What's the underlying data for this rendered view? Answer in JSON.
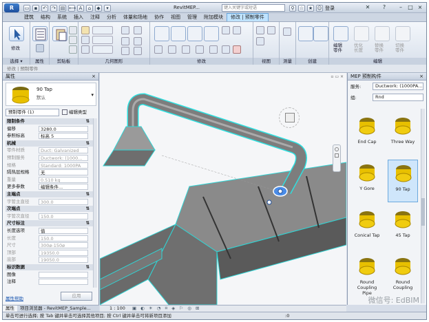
{
  "window": {
    "title": "RevitMEP...",
    "search_placeholder": "键入关键字或短语",
    "user": "登录",
    "help": "?",
    "min": "–",
    "restore": "□",
    "close": "×",
    "switch": "✕"
  },
  "app_button": "R",
  "tabs": [
    "建筑",
    "结构",
    "系统",
    "插入",
    "注释",
    "分析",
    "体量和场地",
    "协作",
    "视图",
    "管理",
    "附加模块",
    "修改 | 预制零件"
  ],
  "ribbon": {
    "panels": [
      "选择 ▾",
      "属性",
      "剪贴板",
      "几何图形",
      "修改",
      "视图",
      "测量",
      "创建",
      "编辑"
    ],
    "modify_label": "修改",
    "edit_part_labels": [
      "编辑\n零件",
      "优化\n长度",
      "替换\n零件",
      "切换\n零件"
    ]
  },
  "options_bar": "修改 | 预制零件",
  "properties": {
    "title": "属性",
    "type_name": "90 Tap",
    "type_sub": "默认",
    "filter": "预制零件 (1)",
    "edit_type": "编辑类型",
    "rows": [
      {
        "k": "限制条件",
        "sec": true
      },
      {
        "k": "偏移",
        "v": "3280.0"
      },
      {
        "k": "参照标高",
        "v": "标高 5"
      },
      {
        "k": "机械",
        "sec": true
      },
      {
        "k": "零件材质",
        "v": "Duct: Galvanized",
        "grey": true
      },
      {
        "k": "预制服务",
        "v": "Ductwork: (1000...",
        "grey": true
      },
      {
        "k": "规格",
        "v": "Standard: 1000PA",
        "grey": true
      },
      {
        "k": "隔热层规格",
        "v": "无"
      },
      {
        "k": "重量",
        "v": "0.510 kg",
        "grey": true
      },
      {
        "k": "更多参数",
        "v": "编辑条件..."
      },
      {
        "k": "主端点",
        "sec": true
      },
      {
        "k": "宇管主直径",
        "v": "300.0",
        "grey": true
      },
      {
        "k": "次端点",
        "sec": true
      },
      {
        "k": "宇管次直径",
        "v": "150.0",
        "grey": true
      },
      {
        "k": "尺寸标注",
        "sec": true
      },
      {
        "k": "长度选项",
        "v": "值"
      },
      {
        "k": "长度",
        "v": "150.0",
        "grey": true
      },
      {
        "k": "尺寸",
        "v": "300ø-150ø",
        "grey": true
      },
      {
        "k": "顶部",
        "v": "19350.0",
        "grey": true
      },
      {
        "k": "底部",
        "v": "19050.0",
        "grey": true
      },
      {
        "k": "标识数据",
        "sec": true
      },
      {
        "k": "图像",
        "v": ""
      },
      {
        "k": "注释",
        "v": ""
      }
    ],
    "help_link": "属性帮助",
    "apply": "应用"
  },
  "bottom_tabs": [
    "属性",
    "项目浏览器 - RevitMEP_Sample..."
  ],
  "view_bar": {
    "scale": "1 : 100"
  },
  "mep_panel": {
    "title": "MEP 预制构件",
    "service_label": "服务:",
    "service_value": "Ductwork: (1000PA...",
    "group_label": "组:",
    "group_value": "Rnd",
    "tiles": [
      {
        "label": "End Cap",
        "selected": false
      },
      {
        "label": "Three Way",
        "selected": false
      },
      {
        "label": "Y Gore",
        "selected": false
      },
      {
        "label": "90 Tap",
        "selected": true
      },
      {
        "label": "Conical Tap",
        "selected": false
      },
      {
        "label": "45 Tap",
        "selected": false
      },
      {
        "label": "Round\nCoupling Pipe",
        "selected": false
      },
      {
        "label": "Round\nCoupling",
        "selected": false
      }
    ]
  },
  "status": "单击可进行选择; 按 Tab 键并单击可选择其他项目; 按 Ctrl 键并单击可将新项目添加",
  "status_right": ":0",
  "watermark": "微信号: EdBIM",
  "colors": {
    "accent": "#3e7fce",
    "tab_active": "#bfe3ff",
    "selection": "#00e5e5",
    "duct": "#6e6e6e",
    "part": "#e8c000"
  }
}
